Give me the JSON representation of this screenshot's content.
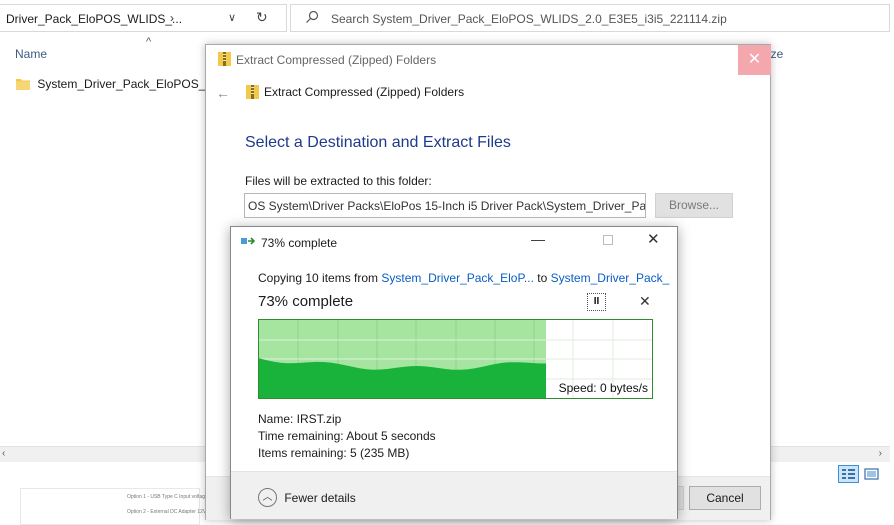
{
  "explorer": {
    "address_text": "Driver_Pack_EloPOS_WLIDS_...",
    "search_placeholder": "Search System_Driver_Pack_EloPOS_WLIDS_2.0_E3E5_i3i5_221114.zip",
    "columns": {
      "name": "Name",
      "size": "ize"
    },
    "file_name": "System_Driver_Pack_EloPOS_WL",
    "preview_lines": [
      "Option 1 - USB Type C Input voltage",
      "Option 2 - External DC Adapter 12V"
    ]
  },
  "extract_dialog": {
    "title": "Extract Compressed (Zipped) Folders",
    "heading": "Extract Compressed (Zipped) Folders",
    "main_instruction": "Select a Destination and Extract Files",
    "destination_label": "Files will be extracted to this folder:",
    "destination_value": "OS System\\Driver Packs\\EloPos 15-Inch i5 Driver Pack\\System_Driver_Pack_",
    "browse_label": "Browse...",
    "cancel_label": "Cancel"
  },
  "copy_dialog": {
    "title": "73% complete",
    "copy_prefix": "Copying 10 items from ",
    "source_link": "System_Driver_Pack_EloP...",
    "to_text": " to ",
    "dest_link": "System_Driver_Pack_",
    "percent_text": "73% complete",
    "progress": 0.73,
    "speed": "Speed: 0 bytes/s",
    "name": "Name: IRST.zip",
    "time_remaining": "Time remaining: About 5 seconds",
    "items_remaining": "Items remaining: 5 (235 MB)",
    "fewer_details": "Fewer details"
  },
  "colors": {
    "progress_light": "#a6e5a0",
    "progress_dark": "#19b33b",
    "link": "#0a5dc2",
    "heading": "#1e3a8a",
    "close_hover": "#f4a8ae"
  }
}
